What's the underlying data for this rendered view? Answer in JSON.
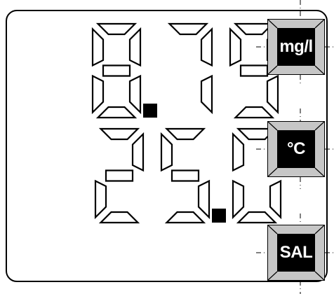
{
  "meter": {
    "primary_reading": "8.79",
    "secondary_reading": "25.0",
    "buttons": [
      {
        "id": "mg-l",
        "label": "mg/l"
      },
      {
        "id": "deg-c",
        "label": "°C"
      },
      {
        "id": "sal",
        "label": "SAL"
      }
    ]
  },
  "colors": {
    "segment": "#000000",
    "button_bevel": "#c6c6c6",
    "button_face": "#000000",
    "button_text": "#ffffff"
  }
}
